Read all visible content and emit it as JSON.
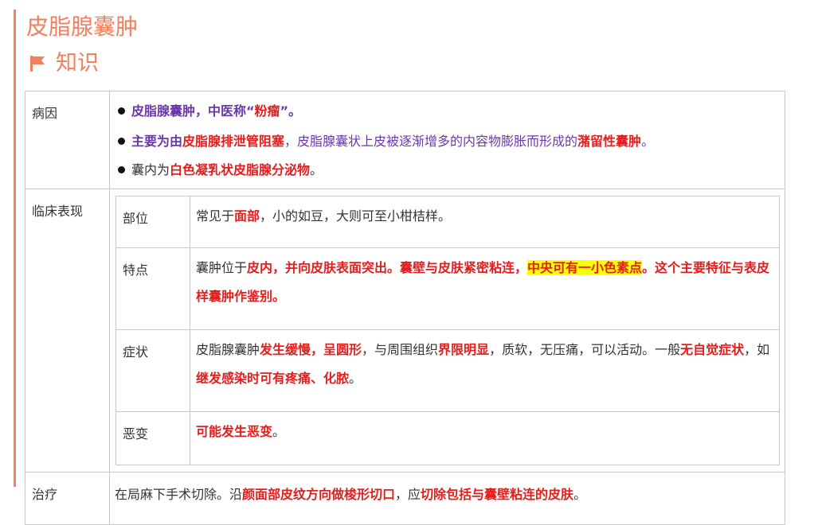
{
  "title": "皮脂腺囊肿",
  "subheading": "知识",
  "rows": {
    "cause_label": "病因",
    "cause": {
      "b1": [
        "皮脂腺囊肿，中医称“",
        "粉瘤",
        "”。"
      ],
      "b2": [
        "主要为由",
        "皮脂腺排泄管阻塞",
        "，皮脂腺囊状上皮被逐渐增多的内容物膨胀而形成的",
        "潴留性囊肿",
        "。"
      ],
      "b3": [
        "囊内为",
        "白色凝乳状皮脂腺分泌物",
        "。"
      ]
    },
    "clinical_label": "临床表现",
    "clinical": {
      "site_label": "部位",
      "site": [
        "常见于",
        "面部",
        "，小的如豆，大则可至小柑桔样。"
      ],
      "feature_label": "特点",
      "feature": [
        "囊肿位于",
        "皮内，并向皮肤表面突出。囊壁与皮肤紧密粘连，",
        "中央可有一小色素点",
        "。这个主要特征与表皮样囊肿作鉴别。"
      ],
      "symptom_label": "症状",
      "symptom": [
        " 皮脂腺囊肿",
        "发生缓慢，呈圆形",
        "，与周围组织",
        "界限明显",
        "，质软，无压痛，可以活动。一般",
        "无自觉症状",
        "，如",
        "继发感染时可有疼痛、化脓",
        "。"
      ],
      "malignant_label": "恶变",
      "malignant": [
        "可能发生恶变",
        "。"
      ]
    },
    "treatment_label": "治疗",
    "treatment": [
      "在局麻下手术切除。沿",
      "颜面部皮纹方向做梭形切口",
      "，应",
      "切除包括与囊壁粘连的皮肤",
      "。"
    ]
  },
  "icons": {
    "subheading_icon": "flag-icon"
  },
  "colors": {
    "accent": "#f0805e",
    "purple": "#6b38a8",
    "red": "#e41d1d",
    "highlight": "#ffff00"
  }
}
